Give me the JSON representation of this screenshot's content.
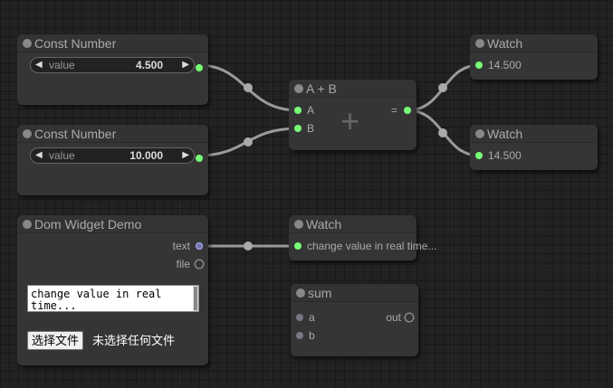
{
  "nodes": {
    "const1": {
      "title": "Const Number",
      "widget_label": "value",
      "widget_value": "4.500"
    },
    "const2": {
      "title": "Const Number",
      "widget_label": "value",
      "widget_value": "10.000"
    },
    "add": {
      "title": "A + B",
      "input_a": "A",
      "input_b": "B",
      "output": "=",
      "symbol": "+"
    },
    "watch1": {
      "title": "Watch",
      "value": "14.500"
    },
    "watch2": {
      "title": "Watch",
      "value": "14.500"
    },
    "dom_widget": {
      "title": "Dom Widget Demo",
      "output_text": "text",
      "output_file": "file",
      "textarea_value": "change value in real time...",
      "file_button": "选择文件",
      "file_status": "未选择任何文件"
    },
    "watch3": {
      "title": "Watch",
      "value": "change value in real time..."
    },
    "sum": {
      "title": "sum",
      "input_a": "a",
      "input_b": "b",
      "output": "out"
    }
  },
  "colors": {
    "background": "#222222",
    "node_body": "#353535",
    "link": "#9a9a9a",
    "connected_slot": "#77ff77",
    "text_slot": "#7777aa"
  }
}
